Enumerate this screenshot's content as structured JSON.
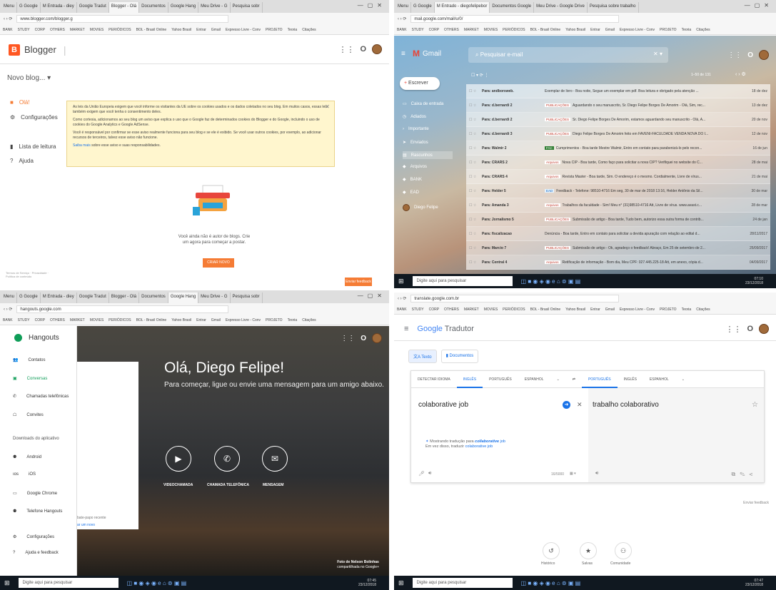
{
  "chrome": {
    "q1_tabs": [
      "Menu",
      "G Google",
      "M Entrada - diey",
      "Google Tradut",
      "Blogger - Olá",
      "Documentos",
      "Google Hang",
      "Meu Drive - G",
      "Pesquisa sobr"
    ],
    "q2_tabs": [
      "Menu",
      "G Google",
      "M Entrado - diegofelipebor",
      "Documentos Google",
      "Meu Drive - Google Drive",
      "Pesquisa sobre trabalho"
    ],
    "q1_url": "www.blogger.com/blogger.g",
    "q2_url": "mail.google.com/mail/u/0/",
    "q3_url": "hangouts.google.com",
    "q4_url": "translate.google.com.br",
    "bookmarks": [
      "BANK",
      "STUDY",
      "CORP",
      "OTHERS",
      "MARKET",
      "MOVIES",
      "PERIÓDICOS",
      "BOL - Brasil Online",
      "Yahoo Brasil",
      "Entrar",
      "Gmail",
      "Expresso Livre - Conv",
      "PROJETO",
      "Teoria",
      "Citações"
    ]
  },
  "blogger": {
    "product": "Blogger",
    "new_blog": "Novo blog...",
    "nav": [
      "Olá!",
      "Configurações",
      "Lista de leitura",
      "Ajuda"
    ],
    "cookie_p1": "As leis da União Europeia exigem que você informe os visitantes da UE sobre os cookies usados e os dados coletados no seu blog. Em muitos casos, essas leis também exigem que você tenha o consentimento deles.",
    "cookie_p2": "Como cortesia, adicionamos ao seu blog um aviso que explica o uso que o Google faz de determinados cookies do Blogger e do Google, incluindo o uso de cookies do Google Analytics e Google AdSense.",
    "cookie_p3": "Você é responsável por confirmar se esse aviso realmente funciona para seu blog e se ele é exibido. Se você usar outros cookies, por exemplo, ao adicionar recursos de terceiros, talvez esse aviso não funcione.",
    "cookie_link": "Saiba mais",
    "cookie_link_rest": "sobre esse aviso e suas responsabilidades.",
    "no_blog": "Você ainda não é autor de blogs. Crie um agora para começar a postar.",
    "create_button": "CRIAR NOVO BLOG",
    "footer": "Termos de Serviço · Privacidade · Política de conteúdo",
    "feedback": "Enviar feedback"
  },
  "gmail": {
    "product": "Gmail",
    "search_placeholder": "Pesquisar e-mail",
    "compose": "Escrever",
    "nav": [
      "Caixa de entrada",
      "Adiados",
      "Importante",
      "Enviados",
      "Rascunhos",
      "Arquivos",
      "BANK",
      "EAD"
    ],
    "count": "1–50 de 131",
    "account": "Diego Felipe",
    "rows": [
      {
        "from": "Para: andborsweb.",
        "label": "",
        "subject": "Exemplar de livro - Boa noite, Segue um exemplar em pdf. Boa leitura e obrigado pela atenção ...",
        "date": "18 de dez"
      },
      {
        "from": "Para: d.bernardi 2",
        "label": "PUBLICAÇÕES",
        "subject": "Aguardando o seu manuscrito, Sr. Diego Felipe Borges De Amorim - Olá, Sim, rec...",
        "date": "13 de dez"
      },
      {
        "from": "Para: d.bernardi 2",
        "label": "PUBLICAÇÕES",
        "subject": "Sr. Diego Felipe Borges De Amorim, estamos aguardando seu manuscrito - Olá, A...",
        "date": "20 de nov"
      },
      {
        "from": "Para: d.bernardi 3",
        "label": "PUBLICAÇÕES",
        "subject": "Diego Felipe Borges De Amorim feito em FAVENI-FACULDADE VENDA NOVA DO I...",
        "date": "12 de nov"
      },
      {
        "from": "Para: Walmir 2",
        "label": "FAC",
        "subject": "Cumprimentos - Boa tarde Mestre Walmir, Entro em contato para parabenizá-lo pelo recon...",
        "date": "16 de jun"
      },
      {
        "from": "Para: CRARS 2",
        "label": "Arquivos",
        "subject": "Nova CIP - Boa tarde, Como faço para solicitar a nova CIP? Verifiquei no website do C...",
        "date": "28 de mai"
      },
      {
        "from": "Para: CRARS 4",
        "label": "Arquivos",
        "subject": "Revista Master - Boa tarde, Sim. O endereço é o mesmo. Cordialmente, Livre de vírus...",
        "date": "21 de mai"
      },
      {
        "from": "Para: Helder 5",
        "label": "EAD",
        "subject": "Feedback - Telefone: 98510-4716 Em seg, 30 de mar de 2018 13:16, Helder Antônio da Sil...",
        "date": "30 de mar"
      },
      {
        "from": "Para: Amanda 3",
        "label": "Arquivos",
        "subject": "Trabalhos da faculdade - Sim! Meu n° (31)98510-4716 Att, Livre de vírus. www.avast.c...",
        "date": "28 de mar"
      },
      {
        "from": "Para: Jornalismo 5",
        "label": "PUBLICAÇÕES",
        "subject": "Submissão de artigo - Boa tarde, Tudo bem, autorizo essa outra forma de contrib...",
        "date": "24 de jan"
      },
      {
        "from": "Para: fiscalizacao",
        "label": "",
        "subject": "Denúncia - Boa tarde, Entro em contato para solicitar a devida apuração com relação ao edital d...",
        "date": "28/11/2017"
      },
      {
        "from": "Para: Marcio 7",
        "label": "PUBLICAÇÕES",
        "subject": "Submissão de artigo - Ok, agradeço o feedback! Abraço, Em 25 de setembro de 2...",
        "date": "25/09/2017"
      },
      {
        "from": "Para: Central 4",
        "label": "Arquivos",
        "subject": "Retificação de informação - Bom dia, Meu CPF: 027.445.225-18 Att, em anexo, cópia d...",
        "date": "04/09/2017"
      }
    ]
  },
  "taskbar": {
    "search": "Digite aqui para pesquisar",
    "time_q2": "07:10",
    "time_q3": "07:45",
    "time_q4": "07:47",
    "date": "23/12/2018"
  },
  "hangouts": {
    "product": "Hangouts",
    "nav": [
      "Contatos",
      "Conversas",
      "Chamadas telefônicas",
      "Convites"
    ],
    "downloads_title": "Downloads do aplicativo",
    "downloads": [
      "Android",
      "iOS",
      "Google Chrome",
      "Telefone Hangouts"
    ],
    "settings": "Configurações",
    "help": "Ajuda e feedback",
    "greeting": "Olá, Diego Felipe!",
    "subtitle": "Para começar, ligue ou envie uma mensagem para um amigo abaixo.",
    "actions": [
      "VIDEOCHAMADA",
      "CHAMADA TELEFÔNICA",
      "MENSAGEM"
    ],
    "card_text": "bate-papo recente",
    "card_link": "ar um novo",
    "credit_line1": "Foto de Nelson Bolinhas",
    "credit_line2": "compartilhada no Google+"
  },
  "translate": {
    "product_google": "Google",
    "product_name": "Tradutor",
    "tabs": [
      "Texto",
      "Documentos"
    ],
    "src_langs": [
      "DETECTAR IDIOMA",
      "INGLÊS",
      "PORTUGUÊS",
      "ESPANHOL"
    ],
    "tgt_langs": [
      "PORTUGUÊS",
      "INGLÊS",
      "ESPANHOL"
    ],
    "source_text": "colaborative job",
    "target_text": "trabalho colaborativo",
    "hint_prefix": "Mostrando tradução para",
    "hint_word": "collaborative",
    "hint_suffix": "job",
    "hint_line2_prefix": "Em vez disso, traduzir",
    "hint_line2_link": "colaborative job",
    "char_count": "16/5000",
    "feedback": "Enviar feedback",
    "features": [
      "Histórico",
      "Salvas",
      "Comunidade"
    ]
  }
}
